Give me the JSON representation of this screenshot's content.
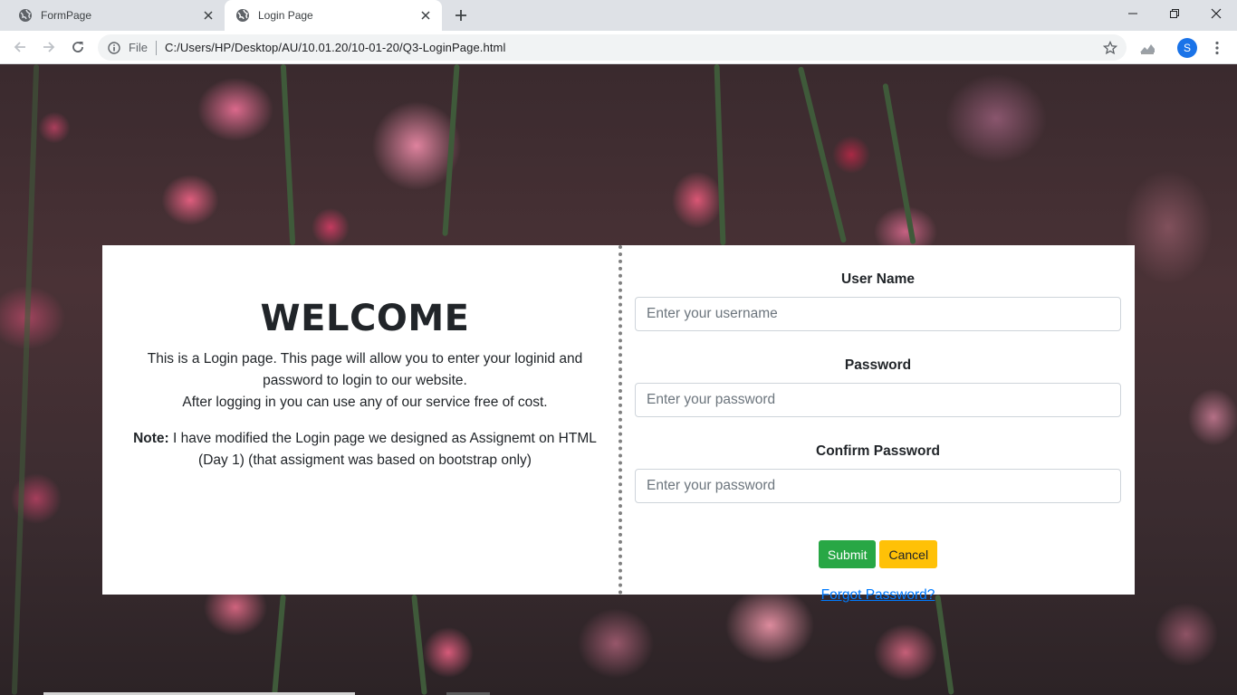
{
  "browser": {
    "tabs": [
      {
        "title": "FormPage",
        "active": false
      },
      {
        "title": "Login Page",
        "active": true
      }
    ],
    "address": {
      "scheme": "File",
      "url": "C:/Users/HP/Desktop/AU/10.01.20/10-01-20/Q3-LoginPage.html"
    },
    "profile_initial": "S",
    "icons": {
      "favicon": "globe-icon",
      "close": "close-icon",
      "new_tab": "plus-icon",
      "back": "arrow-left-icon",
      "forward": "arrow-right-icon",
      "reload": "reload-icon",
      "info": "info-icon",
      "bookmark": "star-icon",
      "extension": "extension-icon",
      "menu": "kebab-menu-icon",
      "minimize": "minimize-icon",
      "restore": "restore-icon",
      "window_close": "window-close-icon"
    },
    "colors": {
      "tabstrip": "#dee1e6",
      "avatar": "#1a73e8"
    }
  },
  "page": {
    "welcome": {
      "heading": "WELCOME",
      "intro_line1": "This is a Login page. This page will allow you to enter your loginid and password to login to our website.",
      "intro_line2": "After logging in you can use any of our service free of cost.",
      "note_label": "Note:",
      "note_text": " I have modified the Login page we designed as Assignemt on HTML (Day 1) (that assigment was based on bootstrap only)"
    },
    "form": {
      "username_label": "User Name",
      "username_placeholder": "Enter your username",
      "username_value": "",
      "password_label": "Password",
      "password_placeholder": "Enter your password",
      "password_value": "",
      "confirm_label": "Confirm Password",
      "confirm_placeholder": "Enter your password",
      "confirm_value": "",
      "submit_label": "Submit",
      "cancel_label": "Cancel",
      "forgot_label": "Forgot Password?"
    },
    "colors": {
      "submit": "#28a745",
      "cancel": "#ffc107",
      "link": "#007bff",
      "divider": "#808080"
    }
  }
}
